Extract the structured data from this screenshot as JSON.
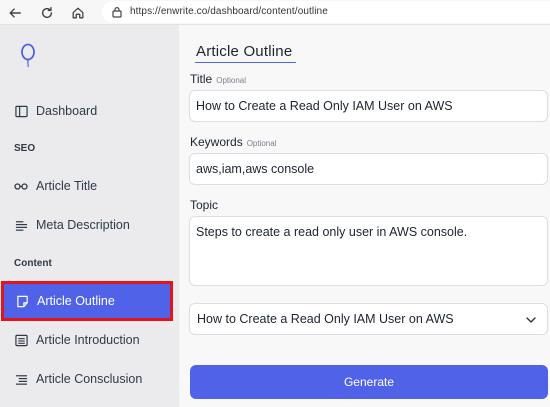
{
  "browser": {
    "url": "https://enwrite.co/dashboard/content/outline",
    "icons": [
      "back-icon",
      "reload-icon",
      "home-icon",
      "lock-icon"
    ]
  },
  "sidebar": {
    "logo_icon": "balloon-logo-icon",
    "items": [
      {
        "label": "Dashboard",
        "icon": "layout-icon"
      },
      {
        "section": "SEO"
      },
      {
        "label": "Article Title",
        "icon": "glasses-icon"
      },
      {
        "label": "Meta Description",
        "icon": "text-lines-icon"
      },
      {
        "section": "Content"
      },
      {
        "label": "Article Outline",
        "icon": "note-icon",
        "active": true
      },
      {
        "label": "Article Introduction",
        "icon": "list-box-icon"
      },
      {
        "label": "Article Consclusion",
        "icon": "list-icon"
      }
    ]
  },
  "main": {
    "title": "Article Outline",
    "title_field": {
      "label": "Title",
      "optional": "Optional",
      "value": "How to Create a Read Only IAM User on AWS"
    },
    "keywords_field": {
      "label": "Keywords",
      "optional": "Optional",
      "value": "aws,iam,aws console"
    },
    "topic_field": {
      "label": "Topic",
      "value": "Steps to create a read only user in AWS console."
    },
    "select": {
      "value": "How to Create a Read Only IAM User on AWS"
    },
    "generate_label": "Generate"
  },
  "colors": {
    "accent": "#5063e8",
    "highlight_border": "#e2141c",
    "sidebar_bg": "#ebebee"
  }
}
